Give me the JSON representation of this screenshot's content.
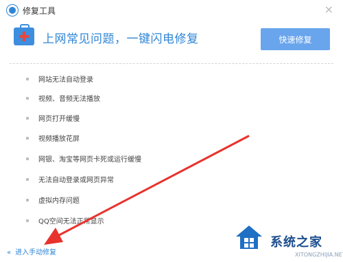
{
  "window": {
    "title": "修复工具",
    "close_glyph": "×"
  },
  "banner": {
    "headline": "上网常见问题，一键闪电修复",
    "fix_button_label": "快速修复",
    "icon": "first-aid-kit-icon"
  },
  "issues": [
    "网站无法自动登录",
    "视频、音频无法播放",
    "网页打开缓慢",
    "视频播放花屏",
    "网银、淘宝等网页卡死或运行缓慢",
    "无法自动登录或网页异常",
    "虚拟内存问题",
    "QQ空间无法正常显示"
  ],
  "footer": {
    "chevron": "«",
    "manual_fix_label": "进入手动修复"
  },
  "watermark": {
    "brand": "系统之家",
    "url": "XITONGZHIJIA.NET"
  },
  "colors": {
    "accent": "#2f86d6",
    "button": "#69a5ed",
    "arrow": "#e8322c",
    "first_aid_cross": "#e8453c"
  }
}
